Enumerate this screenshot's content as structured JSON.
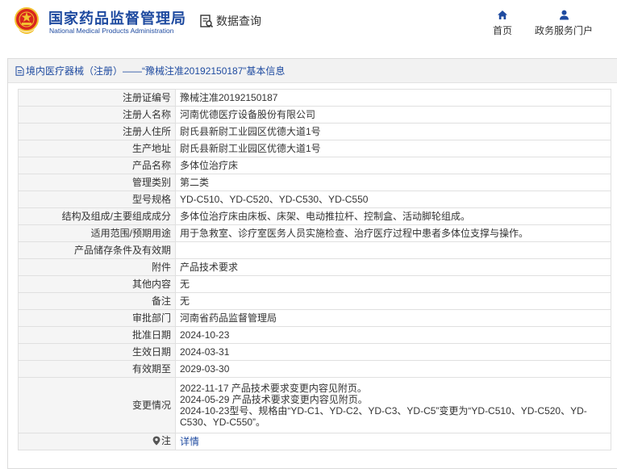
{
  "header": {
    "org_cn": "国家药品监督管理局",
    "org_en": "National Medical Products Administration",
    "db_query": "数据查询",
    "nav_home": "首页",
    "nav_portal": "政务服务门户"
  },
  "panel": {
    "title": "境内医疗器械（注册）——“豫械注准20192150187”基本信息"
  },
  "rows": [
    {
      "label": "注册证编号",
      "value": "豫械注准20192150187"
    },
    {
      "label": "注册人名称",
      "value": "河南优德医疗设备股份有限公司"
    },
    {
      "label": "注册人住所",
      "value": "尉氏县新尉工业园区优德大道1号"
    },
    {
      "label": "生产地址",
      "value": "尉氏县新尉工业园区优德大道1号"
    },
    {
      "label": "产品名称",
      "value": "多体位治疗床"
    },
    {
      "label": "管理类别",
      "value": "第二类"
    },
    {
      "label": "型号规格",
      "value": "YD-C510、YD-C520、YD-C530、YD-C550"
    },
    {
      "label": "结构及组成/主要组成成分",
      "value": "多体位治疗床由床板、床架、电动推拉杆、控制盒、活动脚轮组成。"
    },
    {
      "label": "适用范围/预期用途",
      "value": "用于急救室、诊疗室医务人员实施检查、治疗医疗过程中患者多体位支撑与操作。"
    },
    {
      "label": "产品储存条件及有效期",
      "value": ""
    },
    {
      "label": "附件",
      "value": "产品技术要求"
    },
    {
      "label": "其他内容",
      "value": "无"
    },
    {
      "label": "备注",
      "value": "无"
    },
    {
      "label": "审批部门",
      "value": "河南省药品监督管理局"
    },
    {
      "label": "批准日期",
      "value": "2024-10-23"
    },
    {
      "label": "生效日期",
      "value": "2024-03-31"
    },
    {
      "label": "有效期至",
      "value": "2029-03-30"
    }
  ],
  "changes": {
    "label": "变更情况",
    "lines": [
      "2022-11-17 产品技术要求变更内容见附页。",
      "2024-05-29 产品技术要求变更内容见附页。",
      "2024-10-23型号、规格由“YD-C1、YD-C2、YD-C3、YD-C5”变更为“YD-C510、YD-C520、YD-C530、YD-C550”。"
    ]
  },
  "note": {
    "label": "注",
    "link": "详情"
  },
  "colors": {
    "brand_blue": "#1f4ba0",
    "emblem_red": "#d8261d",
    "emblem_gold": "#f2c230"
  }
}
